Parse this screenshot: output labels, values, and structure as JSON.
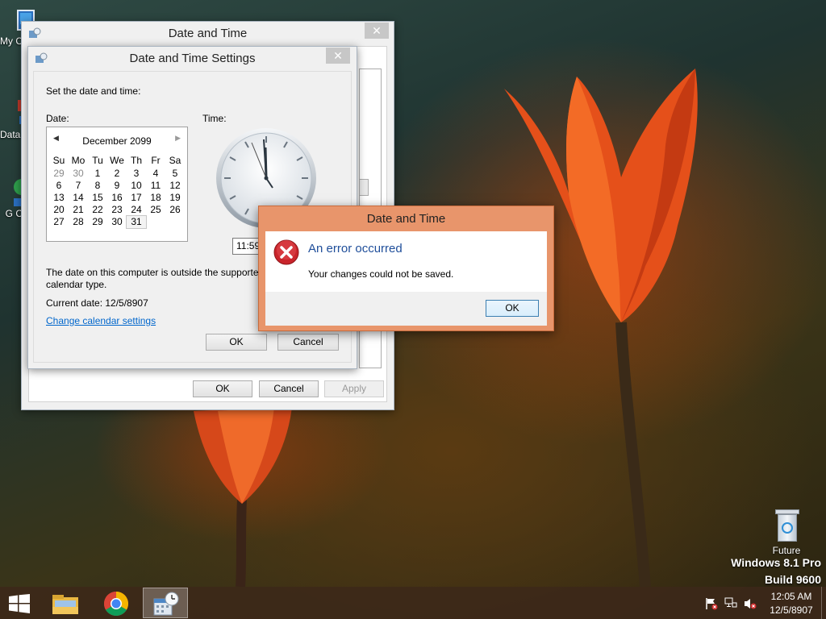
{
  "desktop": {
    "icons": [
      {
        "label": "My C"
      },
      {
        "label": "Data"
      },
      {
        "label": "G C"
      },
      {
        "label": "Future"
      }
    ],
    "watermark": {
      "line1": "Windows 8.1 Pro",
      "line2": "Build 9600"
    }
  },
  "outer_window": {
    "title": "Date and Time",
    "close": "✕",
    "buttons": {
      "ok": "OK",
      "cancel": "Cancel",
      "apply": "Apply"
    }
  },
  "settings_window": {
    "title": "Date and Time Settings",
    "close": "✕",
    "instruction": "Set the date and time:",
    "date_label": "Date:",
    "time_label": "Time:",
    "calendar": {
      "month_year": "December 2099",
      "weekdays": [
        "Su",
        "Mo",
        "Tu",
        "We",
        "Th",
        "Fr",
        "Sa"
      ],
      "weeks": [
        [
          "29",
          "30",
          "1",
          "2",
          "3",
          "4",
          "5"
        ],
        [
          "6",
          "7",
          "8",
          "9",
          "10",
          "11",
          "12"
        ],
        [
          "13",
          "14",
          "15",
          "16",
          "17",
          "18",
          "19"
        ],
        [
          "20",
          "21",
          "22",
          "23",
          "24",
          "25",
          "26"
        ],
        [
          "27",
          "28",
          "29",
          "30",
          "31",
          "",
          ""
        ]
      ],
      "selected": "31"
    },
    "time_value": "11:59",
    "warning_text": "The date on this computer is outside the supported",
    "warning_text2": "calendar type.",
    "current_date": "Current date: 12/5/8907",
    "change_link": "Change calendar settings",
    "buttons": {
      "ok": "OK",
      "cancel": "Cancel"
    }
  },
  "error_dialog": {
    "title": "Date and Time",
    "heading": "An error occurred",
    "message": "Your changes could not be saved.",
    "ok": "OK",
    "heading_color": "#1f4e9a"
  },
  "taskbar": {
    "apps": [
      "start-icon",
      "file-explorer-icon",
      "chrome-icon",
      "date-time-icon"
    ],
    "time": "12:05 AM",
    "date": "12/5/8907"
  }
}
